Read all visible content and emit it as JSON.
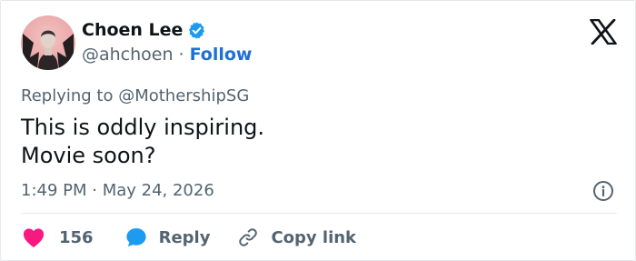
{
  "author": {
    "display_name": "Choen Lee",
    "handle": "@ahchoen",
    "follow_label": "Follow",
    "verified": true,
    "avatar_icon": "user-avatar"
  },
  "header": {
    "separator": "·",
    "logo_icon": "x-logo"
  },
  "tweet": {
    "reply_to": "Replying to @MothershipSG",
    "lines": [
      "This is oddly inspiring.",
      "Movie soon?"
    ],
    "timestamp": "1:49 PM · May 24, 2026"
  },
  "actions": {
    "like_count": "156",
    "reply_label": "Reply",
    "copy_label": "Copy link"
  },
  "colors": {
    "accent": "#1d9bf0",
    "follow": "#1d70d6",
    "like": "#f91880",
    "reply_icon": "#1d9bf0",
    "text": "#0f1419",
    "muted": "#536471"
  }
}
